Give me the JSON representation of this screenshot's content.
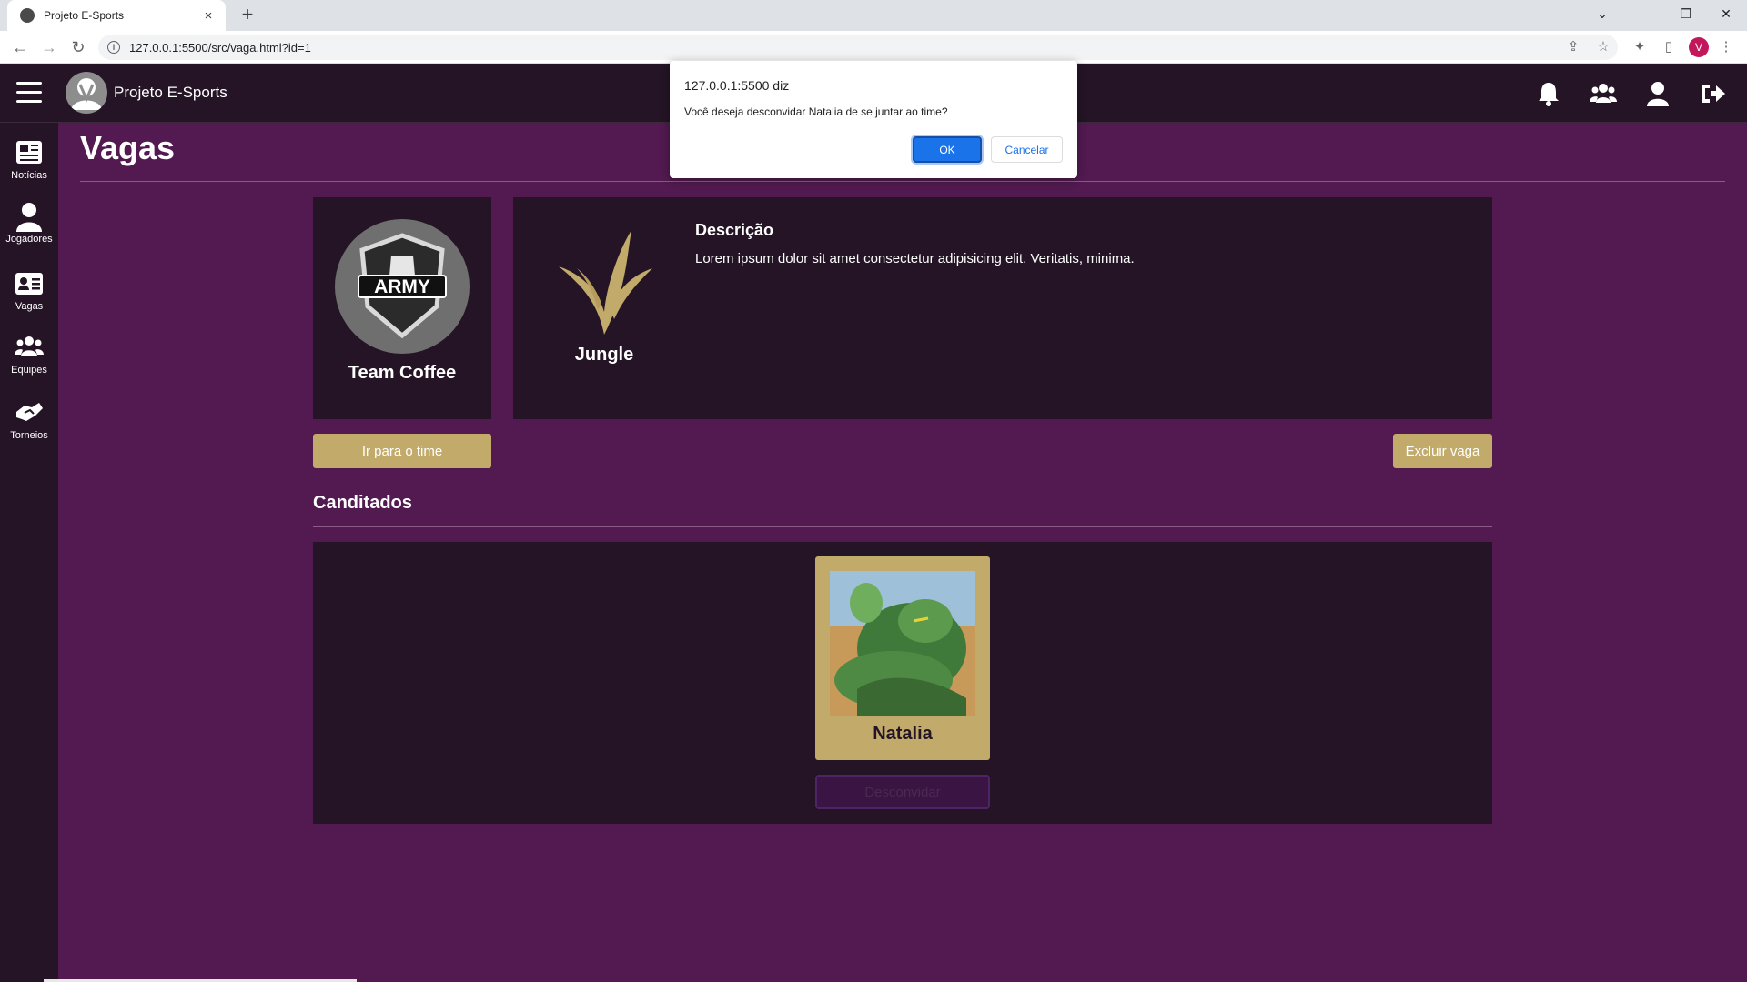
{
  "browser": {
    "tab_title": "Projeto E-Sports",
    "tab_close": "×",
    "new_tab": "+",
    "url": "127.0.0.1:5500/src/vaga.html?id=1",
    "profile_initial": "V"
  },
  "app": {
    "title": "Projeto E-Sports",
    "accent_color": "#c1aa6a",
    "background_color": "#521a50",
    "panel_color": "#241425"
  },
  "sidebar": {
    "items": [
      {
        "label": "Notícias",
        "icon": "newspaper-icon"
      },
      {
        "label": "Jogadores",
        "icon": "user-icon"
      },
      {
        "label": "Vagas",
        "icon": "id-card-icon"
      },
      {
        "label": "Equipes",
        "icon": "users-icon"
      },
      {
        "label": "Torneios",
        "icon": "handshake-icon"
      }
    ]
  },
  "appbar_icons": [
    "bell-icon",
    "users-icon",
    "user-icon",
    "logout-icon"
  ],
  "page": {
    "title": "Vagas",
    "team": {
      "name": "Team Coffee",
      "logo_text": "ARMY"
    },
    "role": {
      "name": "Jungle"
    },
    "description": {
      "title": "Descrição",
      "text": "Lorem ipsum dolor sit amet consectetur adipisicing elit. Veritatis, minima."
    },
    "go_to_team_label": "Ir para o time",
    "delete_label": "Excluir vaga",
    "candidates_title": "Canditados",
    "candidates": [
      {
        "name": "Natalia",
        "action_label": "Desconvidar"
      }
    ]
  },
  "dialog": {
    "origin": "127.0.0.1:5500 diz",
    "message": "Você deseja desconvidar Natalia de se juntar ao time?",
    "ok_label": "OK",
    "cancel_label": "Cancelar"
  }
}
